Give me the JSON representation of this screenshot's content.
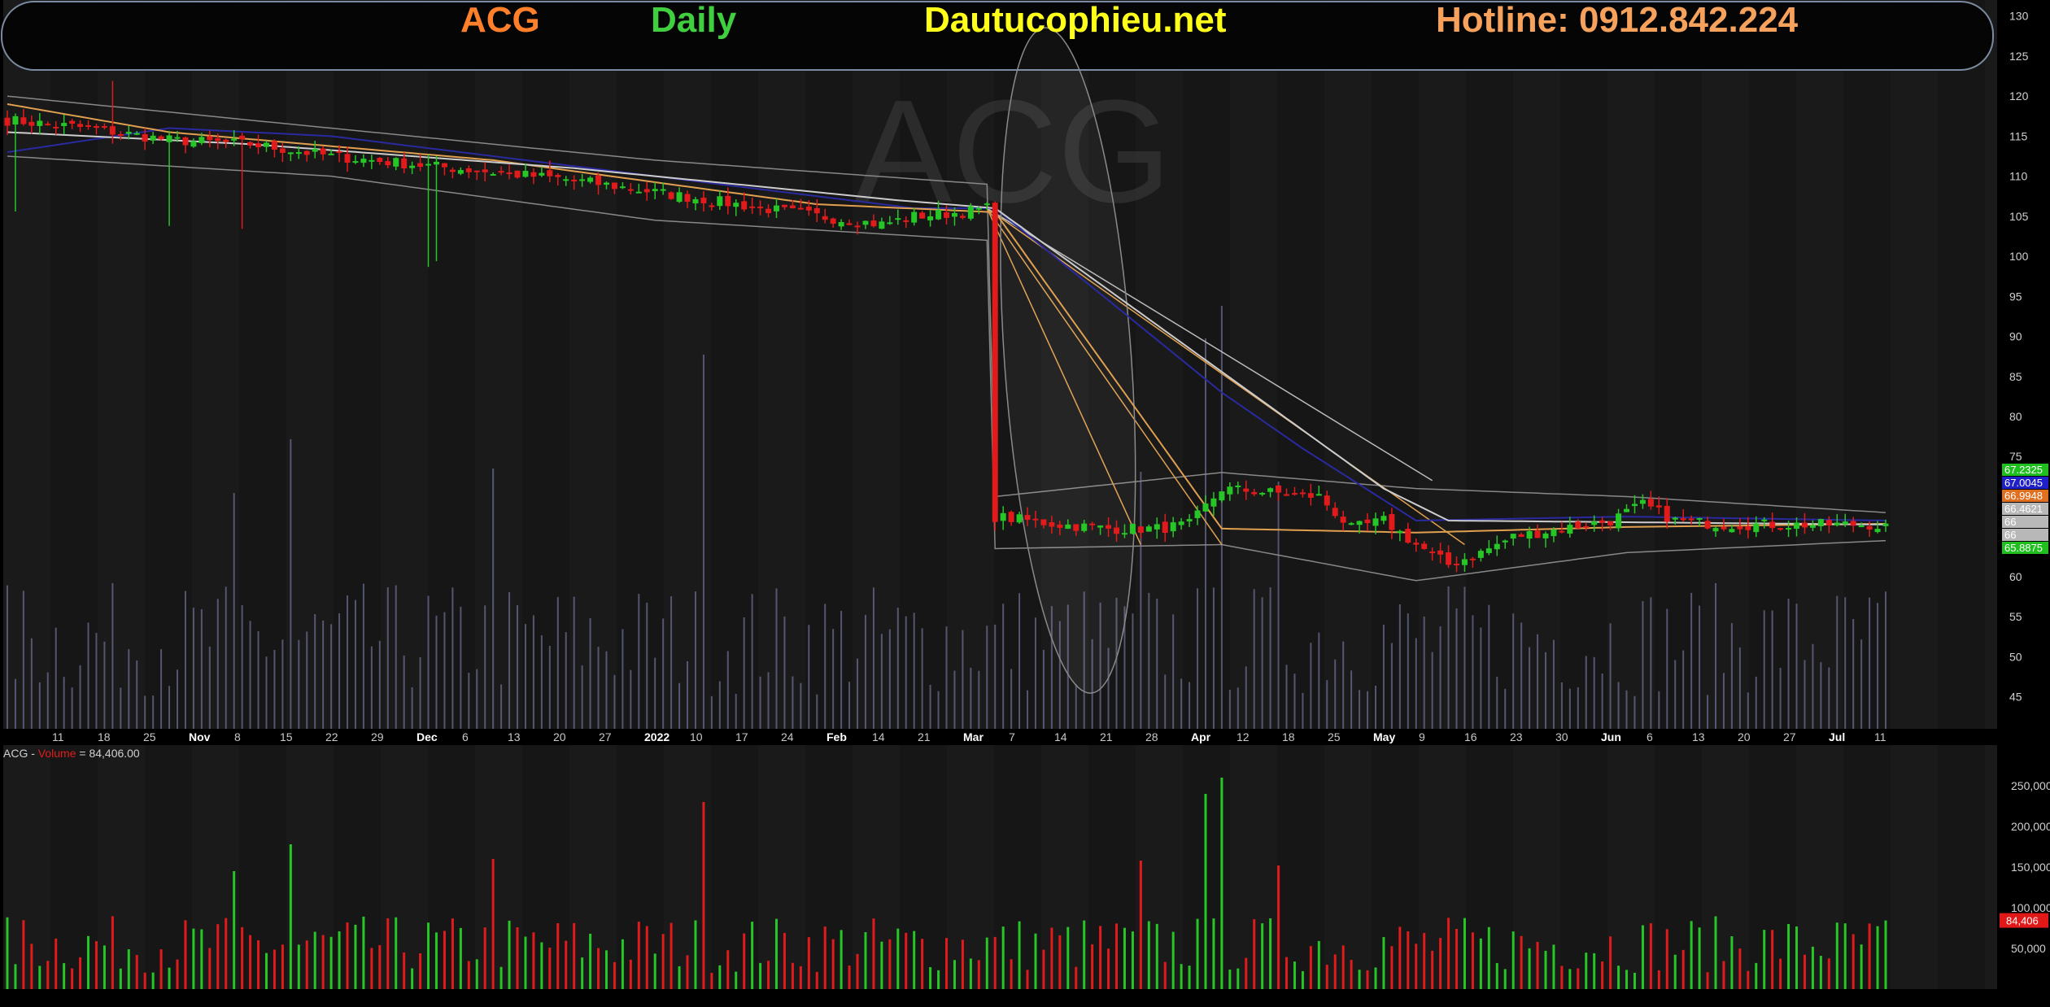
{
  "header": {
    "symbol": "ACG",
    "period": "Daily",
    "site": "Dautucophieu.net",
    "hotline": "Hotline: 0912.842.224"
  },
  "watermark": "ACG",
  "colors": {
    "background": "#000000",
    "panel": "#1a1a1a",
    "panel_alt": "#161616",
    "up": "#27c627",
    "down": "#e11b1b",
    "symbol_text": "#ff7f2a",
    "period_text": "#3fcf3f",
    "site_text": "#ffff1a",
    "hotline_text": "#f7a25c",
    "volume_overlay": "#6f7296",
    "ma_blue": "#2a2aa0",
    "ma_orange": "#e0a050",
    "ma_white": "#cccccc",
    "bollinger": "#888888"
  },
  "chart_data": [
    {
      "type": "candlestick",
      "title": "ACG Daily",
      "ylim": [
        41,
        132
      ],
      "y_ticks": [
        45,
        50,
        55,
        60,
        65,
        70,
        75,
        80,
        85,
        90,
        95,
        100,
        105,
        110,
        115,
        120,
        125,
        130
      ],
      "x_ticks": [
        "11",
        "18",
        "25",
        "Nov",
        "8",
        "15",
        "22",
        "29",
        "Dec",
        "6",
        "13",
        "20",
        "27",
        "2022",
        "10",
        "17",
        "24",
        "Feb",
        "14",
        "21",
        "Mar",
        "7",
        "14",
        "21",
        "28",
        "Apr",
        "12",
        "18",
        "25",
        "May",
        "9",
        "16",
        "23",
        "30",
        "Jun",
        "6",
        "13",
        "20",
        "27",
        "Jul",
        "11"
      ],
      "price_labels": [
        {
          "text": "67.2325",
          "color": "#1fbf1f"
        },
        {
          "text": "67.0045",
          "color": "#2020c8"
        },
        {
          "text": "66.9948",
          "color": "#e07020"
        },
        {
          "text": "66.4621",
          "color": "#b8b8b8"
        },
        {
          "text": "66",
          "color": "#b8b8b8"
        },
        {
          "text": "66",
          "color": "#b8b8b8"
        },
        {
          "text": "65.8875",
          "color": "#1fbf1f"
        }
      ],
      "grid": true,
      "series": [
        {
          "name": "Price",
          "note": "candles are generated from the close path below"
        }
      ],
      "close_path": [
        [
          0,
          117
        ],
        [
          10,
          116
        ],
        [
          20,
          114.5
        ],
        [
          30,
          114
        ],
        [
          40,
          112.5
        ],
        [
          50,
          111.5
        ],
        [
          60,
          110.5
        ],
        [
          70,
          109.5
        ],
        [
          80,
          108
        ],
        [
          90,
          106.5
        ],
        [
          100,
          105
        ],
        [
          108,
          104
        ],
        [
          112,
          105
        ],
        [
          118,
          105.5
        ],
        [
          121,
          106
        ],
        [
          122,
          67.5
        ],
        [
          126,
          67
        ],
        [
          130,
          66.5
        ],
        [
          136,
          66
        ],
        [
          142,
          66
        ],
        [
          146,
          66.5
        ],
        [
          150,
          71
        ],
        [
          156,
          70.5
        ],
        [
          162,
          70
        ],
        [
          166,
          66
        ],
        [
          170,
          67
        ],
        [
          174,
          64
        ],
        [
          178,
          61.5
        ],
        [
          182,
          63
        ],
        [
          186,
          65
        ],
        [
          192,
          66
        ],
        [
          198,
          67
        ],
        [
          202,
          69
        ],
        [
          206,
          67
        ],
        [
          212,
          66.5
        ],
        [
          218,
          66.5
        ],
        [
          224,
          66.5
        ],
        [
          230,
          66.5
        ],
        [
          232,
          66.2
        ]
      ],
      "bands": {
        "upper": [
          [
            0,
            120
          ],
          [
            40,
            116
          ],
          [
            80,
            112
          ],
          [
            121,
            109
          ],
          [
            122,
            70
          ],
          [
            150,
            73
          ],
          [
            174,
            71
          ],
          [
            200,
            70
          ],
          [
            232,
            68
          ]
        ],
        "lower": [
          [
            0,
            112.5
          ],
          [
            40,
            110
          ],
          [
            80,
            104.5
          ],
          [
            121,
            102
          ],
          [
            122,
            63.5
          ],
          [
            150,
            64
          ],
          [
            174,
            59.5
          ],
          [
            200,
            63
          ],
          [
            232,
            64.5
          ]
        ]
      },
      "moving_averages": [
        {
          "color": "#2a2aa0",
          "points": [
            [
              0,
              113
            ],
            [
              20,
              116
            ],
            [
              40,
              115
            ],
            [
              80,
              110
            ],
            [
              112,
              106
            ],
            [
              122,
              106
            ],
            [
              150,
              83
            ],
            [
              160,
              76
            ],
            [
              174,
              67
            ],
            [
              200,
              67.5
            ],
            [
              232,
              67
            ]
          ]
        },
        {
          "color": "#e0a050",
          "points": [
            [
              0,
              119
            ],
            [
              20,
              115.5
            ],
            [
              60,
              112
            ],
            [
              100,
              106.5
            ],
            [
              122,
              105.5
            ],
            [
              150,
              66
            ],
            [
              174,
              65.5
            ],
            [
              200,
              66.2
            ],
            [
              232,
              66.6
            ]
          ]
        },
        {
          "color": "#cccccc",
          "points": [
            [
              0,
              115.5
            ],
            [
              30,
              114
            ],
            [
              70,
              111
            ],
            [
              110,
              107
            ],
            [
              122,
              106
            ],
            [
              170,
              71
            ],
            [
              178,
              67
            ],
            [
              200,
              66.8
            ],
            [
              232,
              66.5
            ]
          ]
        }
      ]
    },
    {
      "type": "bar",
      "title": "ACG - Volume = 84,406.00",
      "label_prefix": "ACG -",
      "label_name": "Volume",
      "label_value": "= 84,406.00",
      "last_value_label": "84,406",
      "ylim": [
        0,
        260000
      ],
      "y_tick_labels": [
        "250,000",
        "200,000",
        "150,000",
        "100,000",
        "50,000"
      ],
      "y_tick_values": [
        250000,
        200000,
        150000,
        100000,
        50000
      ],
      "bar_count": 233,
      "spikes": [
        {
          "index": 28,
          "value": 145000
        },
        {
          "index": 35,
          "value": 178000
        },
        {
          "index": 86,
          "value": 230000
        },
        {
          "index": 148,
          "value": 240000
        },
        {
          "index": 150,
          "value": 260000
        },
        {
          "index": 157,
          "value": 152000
        },
        {
          "index": 140,
          "value": 158000
        },
        {
          "index": 60,
          "value": 160000
        }
      ],
      "last_value": 84406
    }
  ]
}
